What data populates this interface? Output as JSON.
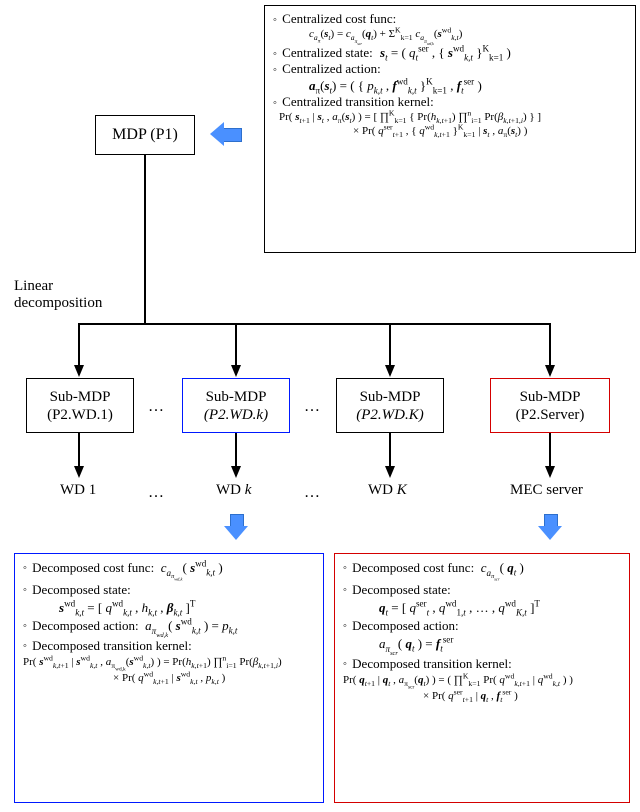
{
  "top": {
    "mdp_label": "MDP (P1)",
    "linear_decomp": "Linear\ndecomposition",
    "central_cost_title": "Centralized cost func:",
    "central_cost_formula": "c_{a_π}(s_t) = c_{a_{π_scr}}(q_t) + Σ_{k=1}^{K} c_{a_{π_wd,k}}(s_{k,t}^{wd})",
    "central_state_title": "Centralized state:",
    "central_state_formula": "s_t = ( q_t^{ser}, { s_{k,t}^{wd} }_{k=1}^{K} )",
    "central_action_title": "Centralized action:",
    "central_action_formula": "a_π(s_t) = ( { p_{k,t}, f_{k,t}^{wd} }_{k=1}^{K} , f_t^{ser} )",
    "central_kernel_title": "Centralized transition kernel:",
    "central_kernel_formula": "Pr( s_{t+1} | s_t , a_π(s_t) ) = [ ∏_{k=1}^{K} { Pr(h_{k,t+1}) ∏_{i=1}^{n} Pr(β_{k,t+1,i}) } ] × Pr( q_{t+1}^{ser}, { q_{k,t+1}^{wd} }_{k=1}^{K} | s_t , a_π(s_t) )"
  },
  "sub_mdps": {
    "sb1_l1": "Sub-MDP",
    "sb1_l2": "(P2.WD.1)",
    "sb2_l1": "Sub-MDP",
    "sb2_l2": "(P2.WD.k)",
    "sb3_l1": "Sub-MDP",
    "sb3_l2": "(P2.WD.K)",
    "sb4_l1": "Sub-MDP",
    "sb4_l2": "(P2.Server)"
  },
  "wd_labels": {
    "wd1": "WD 1",
    "wdk": "WD k",
    "wdK": "WD K",
    "mec": "MEC server"
  },
  "blue": {
    "cost_title": "Decomposed cost func:",
    "cost_formula": "c_{a_{π_wd,k}}( s_{k,t}^{wd} )",
    "state_title": "Decomposed state:",
    "state_formula": "s_{k,t}^{wd} = [ q_{k,t}^{wd} , h_{k,t} , β_{k,t} ]^{T}",
    "action_title": "Decomposed action:",
    "action_formula": "a_{π_wd,k}( s_{k,t}^{wd} ) = p_{k,t}",
    "kernel_title": "Decomposed transition kernel:",
    "kernel_formula": "Pr( s_{k,t+1}^{wd} | s_{k,t}^{wd} , a_{π_wd,k}(s_{k,t}^{wd}) ) = Pr(h_{k,t+1}) ∏_{i=1}^{n} Pr(β_{k,t+1,i}) × Pr( q_{k,t+1}^{wd} | s_{k,t}^{wd} , p_{k,t} )"
  },
  "red": {
    "cost_title": "Decomposed cost func:",
    "cost_formula": "c_{a_{π_scr}}( q_t )",
    "state_title": "Decomposed state:",
    "state_formula": "q_t = [ q_t^{ser} , q_{1,t}^{wd} , … , q_{K,t}^{wd} ]^{T}",
    "action_title": "Decomposed action:",
    "action_formula": "a_{π_scr}( q_t ) = f_t^{ser}",
    "kernel_title": "Decomposed transition kernel:",
    "kernel_formula": "Pr( q_{t+1} | q_t , a_{π_scr}(q_t) ) = ( ∏_{k=1}^{K} Pr( q_{k,t+1}^{wd} | q_{k,t}^{wd} ) ) × Pr( q_{t+1}^{ser} | q_t , f_t^{ser} )"
  },
  "ellipsis": "…"
}
